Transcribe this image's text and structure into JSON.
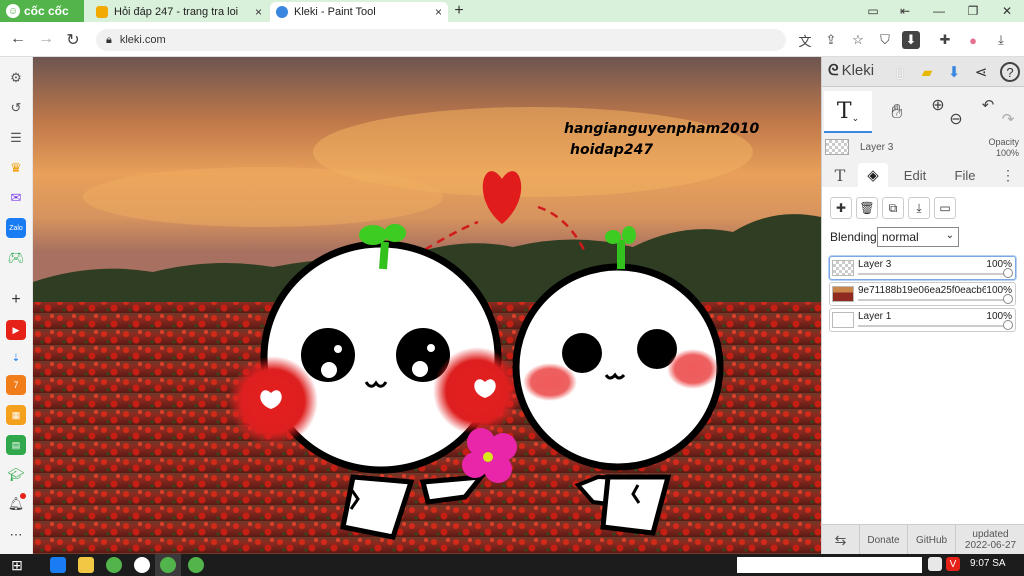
{
  "browser": {
    "brand": "cốc cốc",
    "tabs": [
      {
        "label": "Hỏi đáp 247 - trang tra loi",
        "active": false
      },
      {
        "label": "Kleki - Paint Tool",
        "active": true
      }
    ],
    "url": "kleki.com"
  },
  "canvas": {
    "credit_line1": "hangianguyenpham2010",
    "credit_line2": "hoidap247"
  },
  "panel": {
    "logo": "Kleki",
    "layer_preview_name": "Layer 3",
    "opacity_label": "Opacity",
    "opacity_value": "100%",
    "tabs": {
      "edit": "Edit",
      "file": "File"
    },
    "blending_label": "Blending",
    "blending_value": "normal",
    "layers": [
      {
        "name": "Layer 3",
        "opacity": "100%",
        "selected": true
      },
      {
        "name": "9e71188b19e06ea25f0eacb6(",
        "opacity": "100%",
        "selected": false
      },
      {
        "name": "Layer 1",
        "opacity": "100%",
        "selected": false
      }
    ],
    "footer": {
      "donate": "Donate",
      "github": "GitHub",
      "updated": "updated",
      "date": "2022-06-27"
    }
  },
  "taskbar": {
    "time": "9:07 SA"
  },
  "colors": {
    "accent_green": "#52b44b",
    "kleki_blue": "#3a87e0"
  }
}
